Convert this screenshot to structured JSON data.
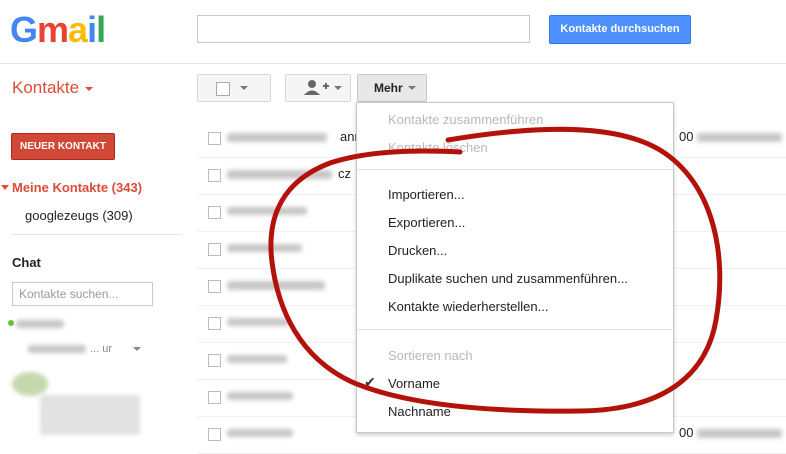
{
  "header": {
    "logo_letters": [
      "G",
      "m",
      "a",
      "i",
      "l"
    ],
    "search_button_label": "Kontakte durchsuchen",
    "search_value": ""
  },
  "sidebar": {
    "title": "Kontakte",
    "new_contact_label": "NEUER KONTAKT",
    "groups": [
      {
        "label": "Meine Kontakte (343)"
      },
      {
        "label": "googlezeugs (309)"
      }
    ],
    "chat_title": "Chat",
    "chat_search_placeholder": "Kontakte suchen...",
    "chat_trail": "... ur"
  },
  "toolbar": {
    "more_label": "Mehr"
  },
  "contact_rows": [
    {
      "suffix": "ann"
    },
    {
      "suffix": "cz"
    },
    {
      "suffix": ""
    },
    {
      "suffix": ""
    },
    {
      "suffix": ""
    },
    {
      "suffix": ""
    },
    {
      "suffix": ""
    },
    {
      "suffix": ""
    },
    {
      "suffix": ""
    }
  ],
  "right_column": {
    "prefix1": "00",
    "prefix2": "00"
  },
  "more_menu": {
    "disabled_top": [
      "Kontakte zusammenführen",
      "Kontakte löschen"
    ],
    "actions": [
      "Importieren...",
      "Exportieren...",
      "Drucken...",
      "Duplikate suchen und zusammenführen...",
      "Kontakte wiederherstellen..."
    ],
    "sort_header": "Sortieren nach",
    "sort_options": [
      {
        "label": "Vorname",
        "checked": true
      },
      {
        "label": "Nachname",
        "checked": false
      }
    ]
  },
  "colors": {
    "accent_red": "#dd4b39",
    "search_blue": "#4d90fe",
    "annotation_red": "#b3120a"
  }
}
